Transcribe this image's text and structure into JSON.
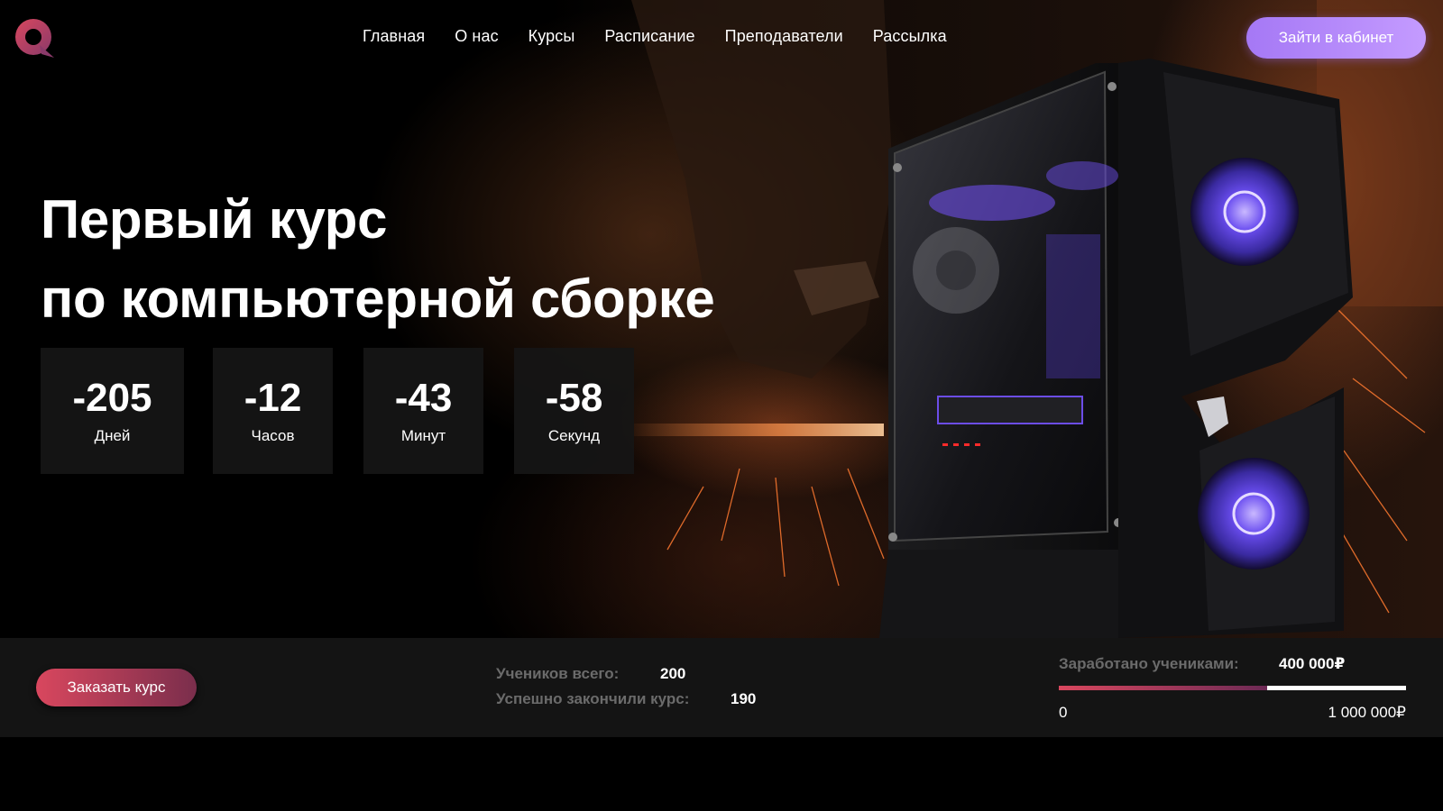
{
  "header": {
    "nav": [
      "Главная",
      "О нас",
      "Курсы",
      "Расписание",
      "Преподаватели",
      "Рассылка"
    ],
    "login_label": "Зайти в кабинет"
  },
  "hero": {
    "title_line1": "Первый курс",
    "title_line2": "по компьютерной сборке",
    "countdown": [
      {
        "value": "-205",
        "label": "Дней"
      },
      {
        "value": "-12",
        "label": "Часов"
      },
      {
        "value": "-43",
        "label": "Минут"
      },
      {
        "value": "-58",
        "label": "Секунд"
      }
    ]
  },
  "stats": {
    "order_label": "Заказать курс",
    "students_total_label": "Учеников всего:",
    "students_total_value": "200",
    "graduated_label": "Успешно закончили курс:",
    "graduated_value": "190",
    "earned_label": "Заработано учениками:",
    "earned_value": "400 000₽",
    "range_min": "0",
    "range_max": "1 000 000₽",
    "earned_fraction": 0.6
  },
  "colors": {
    "accent_purple": "#b28af8",
    "accent_red": "#d9475e",
    "bar_bg": "#141414"
  },
  "icons": {
    "logo": "speech-bubble-logo"
  }
}
